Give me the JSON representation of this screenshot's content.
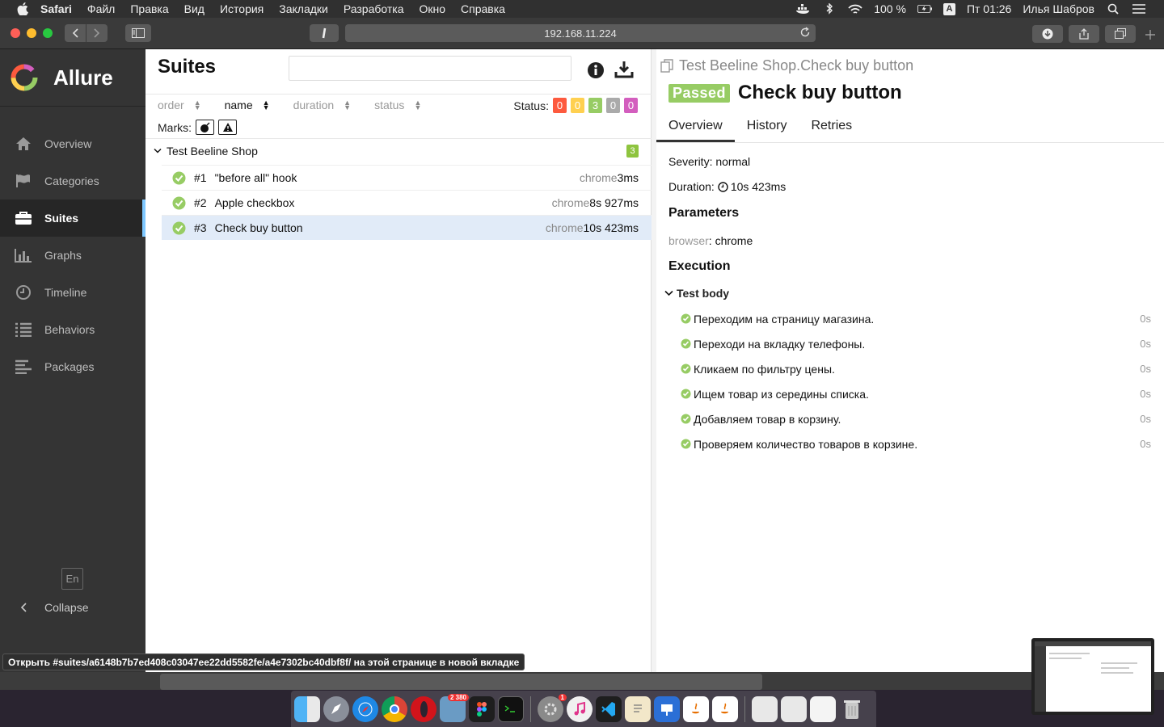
{
  "menubar": {
    "app": "Safari",
    "items": [
      "Файл",
      "Правка",
      "Вид",
      "История",
      "Закладки",
      "Разработка",
      "Окно",
      "Справка"
    ],
    "battery": "100 %",
    "keyboard": "A",
    "clock": "Пт 01:26",
    "user": "Илья Шабров"
  },
  "browser": {
    "url": "192.168.11.224"
  },
  "sidebar": {
    "brand": "Allure",
    "items": [
      {
        "label": "Overview",
        "icon": "home-icon"
      },
      {
        "label": "Categories",
        "icon": "flag-icon"
      },
      {
        "label": "Suites",
        "icon": "briefcase-icon"
      },
      {
        "label": "Graphs",
        "icon": "bar-chart-icon"
      },
      {
        "label": "Timeline",
        "icon": "clock-icon"
      },
      {
        "label": "Behaviors",
        "icon": "list-icon"
      },
      {
        "label": "Packages",
        "icon": "align-left-icon"
      }
    ],
    "active": "Suites",
    "lang": "En",
    "collapse": "Collapse"
  },
  "suites": {
    "title": "Suites",
    "search_placeholder": "",
    "sorters": [
      {
        "label": "order"
      },
      {
        "label": "name"
      },
      {
        "label": "duration"
      },
      {
        "label": "status"
      }
    ],
    "active_sorter": "name",
    "status_label": "Status:",
    "status_counts": [
      {
        "value": "0",
        "color": "#fd5a3e"
      },
      {
        "value": "0",
        "color": "#ffd050"
      },
      {
        "value": "3",
        "color": "#97cc64"
      },
      {
        "value": "0",
        "color": "#aaaaaa"
      },
      {
        "value": "0",
        "color": "#d35ebe"
      }
    ],
    "marks_label": "Marks:",
    "group": {
      "name": "Test Beeline Shop",
      "count": "3"
    },
    "tests": [
      {
        "num": "#1",
        "name": "\"before all\" hook",
        "browser": "chrome",
        "duration": "3ms"
      },
      {
        "num": "#2",
        "name": "Apple checkbox",
        "browser": "chrome",
        "duration": "8s 927ms"
      },
      {
        "num": "#3",
        "name": "Check buy button",
        "browser": "chrome",
        "duration": "10s 423ms"
      }
    ]
  },
  "details": {
    "breadcrumb": "Test Beeline Shop.Check buy button",
    "status": "Passed",
    "title": "Check buy button",
    "tabs": [
      "Overview",
      "History",
      "Retries"
    ],
    "active_tab": "Overview",
    "severity": "Severity: normal",
    "duration_label": "Duration:",
    "duration_value": "10s 423ms",
    "parameters_heading": "Parameters",
    "param_key": "browser",
    "param_value": ": chrome",
    "execution_heading": "Execution",
    "step_group": "Test body",
    "steps": [
      {
        "name": "Переходим на страницу магазина.",
        "duration": "0s"
      },
      {
        "name": "Переходи на вкладку телефоны.",
        "duration": "0s"
      },
      {
        "name": "Кликаем по фильтру цены.",
        "duration": "0s"
      },
      {
        "name": "Ищем товар из середины списка.",
        "duration": "0s"
      },
      {
        "name": "Добавляем товар в корзину.",
        "duration": "0s"
      },
      {
        "name": "Проверяем количество товаров в корзине.",
        "duration": "0s"
      }
    ]
  },
  "statusbar": {
    "link_preview": "Открыть #suites/a6148b7b7ed408c03047ee22dd5582fe/a4e7302bc40dbf8f/ на этой странице в новой вкладке"
  },
  "dock": {
    "badge_mail": "2 380",
    "badge_prefs": "1"
  }
}
